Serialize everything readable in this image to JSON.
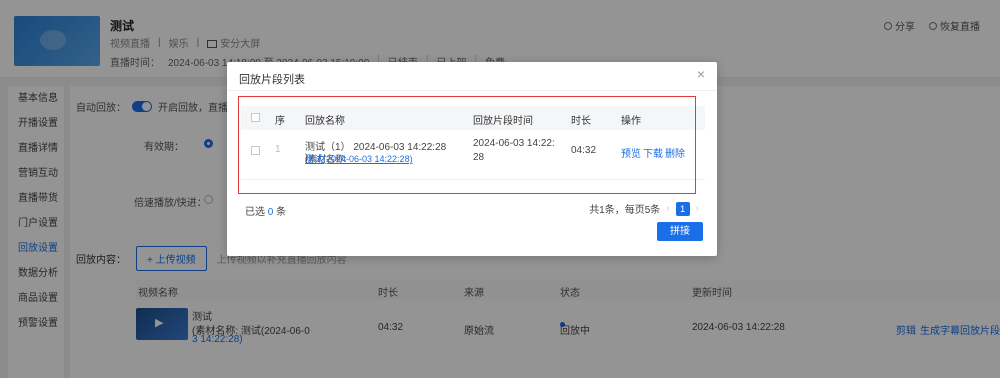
{
  "header": {
    "title": "测试",
    "type_label": "视频直播",
    "category": "娱乐",
    "screen_label": "安分大屏",
    "time_label": "直播时间：",
    "time_range": "2024-06-03 14:18:00 至 2024-06-03 15:10:00",
    "status": "已结束",
    "online": "已上架",
    "extra": "免费",
    "share": "分享",
    "restore": "恢复直播"
  },
  "sidebar": {
    "items": [
      {
        "label": "基本信息"
      },
      {
        "label": "开播设置"
      },
      {
        "label": "直播详情"
      },
      {
        "label": "营销互动"
      },
      {
        "label": "直播带货"
      },
      {
        "label": "门户设置"
      },
      {
        "label": "回放设置"
      },
      {
        "label": "数据分析"
      },
      {
        "label": "商品设置"
      },
      {
        "label": "预警设置"
      }
    ]
  },
  "main": {
    "auto_replay_label": "自动回放：",
    "auto_replay_hint": "开启回放，直播结束后自动生成回放",
    "valid_label": "有效期：",
    "fast_label": "倍速播放/快进：",
    "replay_content_label": "回放内容：",
    "upload_button": "+ 上传视频",
    "upload_hint": "上传视频以补充直播回放内容",
    "table": {
      "headers": [
        "视频名称",
        "时长",
        "来源",
        "状态",
        "更新时间"
      ],
      "row": {
        "name": "测试",
        "material": "(素材名称: 测试(2024-06-0",
        "material2": "3 14:22:28)",
        "duration": "04:32",
        "source": "原始流",
        "status": "回放中",
        "updated": "2024-06-03 14:22:28",
        "actions": [
          "剪辑",
          "生成字幕",
          "回放片段"
        ]
      }
    }
  },
  "modal": {
    "title": "回放片段列表",
    "close": "×",
    "columns": {
      "order": "序",
      "name": "回放名称",
      "created": "回放片段时间",
      "duration": "时长",
      "actions": "操作"
    },
    "rows": [
      {
        "order": "1",
        "name": "测试（1） 2024-06-03 14:22:28",
        "material_label": "(素材名称: ",
        "material_link": "测试(2024-06-03 14:22:28)",
        "material_end": ")",
        "created_line1": "2024-06-03 14:22:",
        "created_line2": "28",
        "duration": "04:32",
        "action_preview": "预览",
        "action_download": "下载",
        "action_delete": "删除"
      }
    ],
    "selected_prefix": "已选",
    "selected_count": "0",
    "selected_suffix": "条",
    "pager_total": "共1条，每页5条",
    "pager_prev": "‹",
    "pager_page": "1",
    "pager_next": "›",
    "confirm": "拼接"
  },
  "colors": {
    "primary": "#1a6fe8",
    "highlight_border": "#e23a3a"
  }
}
